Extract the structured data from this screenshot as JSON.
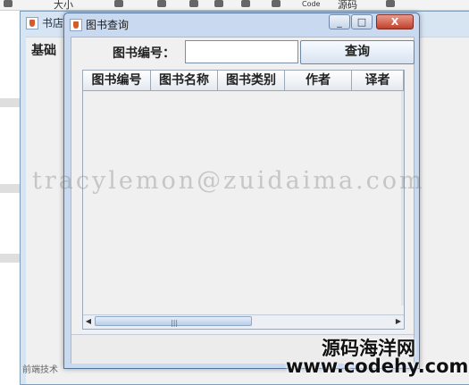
{
  "toolbar": {
    "item_large": "大小",
    "item_code": "Code",
    "item_source": "源码"
  },
  "background_window": {
    "title": "书店",
    "menu_text": "基础",
    "bottom_hint": "前端技术"
  },
  "window": {
    "title": "图书查询",
    "minimize_glyph": "_",
    "maximize_glyph": "□",
    "close_glyph": "X"
  },
  "search": {
    "label": "图书编号：",
    "value": "",
    "button_label": "查询"
  },
  "table": {
    "columns": [
      "图书编号",
      "图书名称",
      "图书类别",
      "作者",
      "译者"
    ],
    "rows": []
  },
  "scrollbar": {
    "left_arrow": "◀",
    "right_arrow": "▶",
    "grip": "|||"
  },
  "overlay": {
    "watermark": "tracylemon@zuidaima.com",
    "site_name": "源码海洋网",
    "site_url": "www.codehy.com"
  }
}
